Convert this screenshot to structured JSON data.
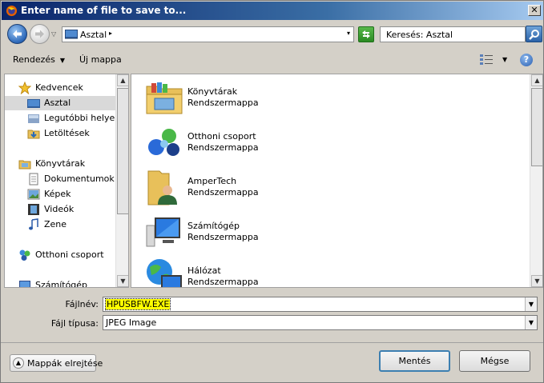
{
  "window": {
    "title": "Enter name of file to save to...",
    "close_glyph": "✕"
  },
  "address": {
    "current_location": "Asztal",
    "chevron": "▸",
    "dropdown": "▾",
    "recent_dropdown": "▽",
    "search_placeholder": "Keresés: Asztal"
  },
  "toolbar": {
    "organize_label": "Rendezés",
    "organize_arrow": "▼",
    "new_folder_label": "Új mappa",
    "view_arrow": "▼",
    "help_glyph": "?"
  },
  "nav": {
    "items": [
      {
        "label": "Kedvencek",
        "icon": "star-icon"
      },
      {
        "label": "Asztal",
        "icon": "desktop-icon",
        "selected": true
      },
      {
        "label": "Legutóbbi helyek",
        "icon": "recent-places-icon"
      },
      {
        "label": "Letöltések",
        "icon": "downloads-icon"
      },
      {
        "label": "Könyvtárak",
        "icon": "libraries-icon"
      },
      {
        "label": "Dokumentumok",
        "icon": "documents-icon"
      },
      {
        "label": "Képek",
        "icon": "pictures-icon"
      },
      {
        "label": "Videók",
        "icon": "videos-icon"
      },
      {
        "label": "Zene",
        "icon": "music-icon"
      },
      {
        "label": "Otthoni csoport",
        "icon": "homegroup-icon"
      },
      {
        "label": "Számítógép",
        "icon": "computer-icon"
      }
    ]
  },
  "files": [
    {
      "name": "Könyvtárak",
      "type": "Rendszermappa",
      "icon": "libraries-folder-icon"
    },
    {
      "name": "Otthoni csoport",
      "type": "Rendszermappa",
      "icon": "homegroup-icon"
    },
    {
      "name": "AmperTech",
      "type": "Rendszermappa",
      "icon": "user-folder-icon"
    },
    {
      "name": "Számítógép",
      "type": "Rendszermappa",
      "icon": "computer-icon"
    },
    {
      "name": "Hálózat",
      "type": "Rendszermappa",
      "icon": "network-icon"
    }
  ],
  "form": {
    "filename_label": "Fájlnév:",
    "filename_value": "HPUSBFW.EXE",
    "filetype_label": "Fájl típusa:",
    "filetype_value": "JPEG Image"
  },
  "buttons": {
    "hide_folders": "Mappák elrejtése",
    "save": "Mentés",
    "cancel": "Mégse",
    "scroll_up": "▲",
    "scroll_down": "▼",
    "collapse_glyph": "▲"
  }
}
